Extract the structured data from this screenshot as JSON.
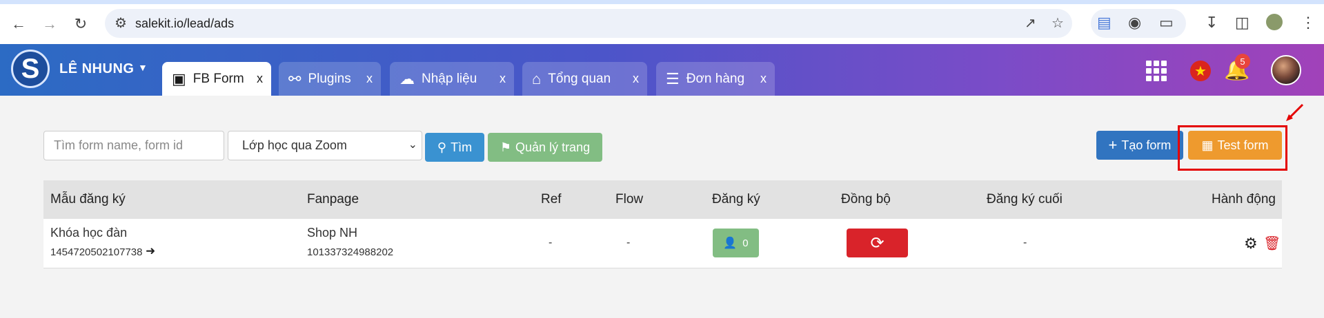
{
  "browser": {
    "url": "salekit.io/lead/ads"
  },
  "header": {
    "user_name": "LÊ NHUNG",
    "tabs": [
      {
        "label": "FB Form",
        "close": "x"
      },
      {
        "label": "Plugins",
        "close": "x"
      },
      {
        "label": "Nhập liệu",
        "close": "x"
      },
      {
        "label": "Tổng quan",
        "close": "x"
      },
      {
        "label": "Đơn hàng",
        "close": "x"
      }
    ],
    "notifications_count": "5"
  },
  "toolbar": {
    "search_placeholder": "Tìm form name, form id",
    "select_value": "Lớp học qua Zoom",
    "find_label": "Tìm",
    "manage_pages_label": "Quản lý trang",
    "create_form_label": "Tạo form",
    "test_form_label": "Test form"
  },
  "table": {
    "headers": [
      "Mẫu đăng ký",
      "Fanpage",
      "Ref",
      "Flow",
      "Đăng ký",
      "Đồng bộ",
      "Đăng ký cuối",
      "Hành động"
    ],
    "rows": [
      {
        "form_name": "Khóa học đàn",
        "form_id": "1454720502107738",
        "fanpage_name": "Shop NH",
        "fanpage_id": "101337324988202",
        "ref": "-",
        "flow": "-",
        "registrations": "0",
        "last_registration": "-"
      }
    ]
  },
  "colors": {
    "find_button": "#3a92d1",
    "manage_pages_button": "#82bd83",
    "create_button": "#3174c0",
    "test_button": "#ee9a2e",
    "sync_button": "#d9232a",
    "highlight": "#e40000"
  }
}
